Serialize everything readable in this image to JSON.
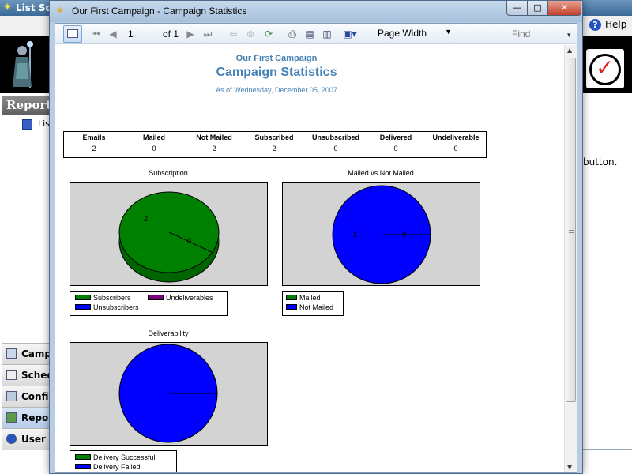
{
  "background_app": {
    "title": "List Sor",
    "help_label": "Help",
    "reports_header": "Report",
    "tree_item": "List",
    "nav_items": [
      "Campa",
      "Sched",
      "Config",
      "Repor",
      "User F"
    ],
    "fragment_text": "button."
  },
  "window": {
    "title": "Our First Campaign - Campaign Statistics",
    "minimize": "—",
    "maximize": "□",
    "close": "✕"
  },
  "toolbar": {
    "page_value": "1",
    "of_label": "of 1",
    "zoom": "Page Width",
    "find_placeholder": "Find"
  },
  "report": {
    "campaign": "Our First Campaign",
    "title": "Campaign Statistics",
    "as_of": "As of Wednesday, December 05, 2007",
    "stats": [
      {
        "label": "Emails",
        "value": "2"
      },
      {
        "label": "Mailed",
        "value": "0"
      },
      {
        "label": "Not Mailed",
        "value": "2"
      },
      {
        "label": "Subscribed",
        "value": "2"
      },
      {
        "label": "Unsubscribed",
        "value": "0"
      },
      {
        "label": "Delivered",
        "value": "0"
      },
      {
        "label": "Undeliverable",
        "value": "0"
      }
    ]
  },
  "colors": {
    "green": "#008000",
    "blue": "#0000ff",
    "purple": "#800080",
    "chart_bg": "#d3d3d3",
    "header_blue": "#4682b4"
  },
  "chart_data": [
    {
      "type": "pie",
      "title": "Subscription",
      "slices": [
        {
          "name": "Subscribers",
          "value": 2,
          "color": "#008000"
        },
        {
          "name": "Undeliverables",
          "value": 0,
          "color": "#800080"
        },
        {
          "name": "Unsubscribers",
          "value": 0,
          "color": "#0000ff"
        }
      ],
      "data_labels": [
        "2",
        "0"
      ]
    },
    {
      "type": "pie",
      "title": "Mailed vs Not Mailed",
      "slices": [
        {
          "name": "Mailed",
          "value": 0,
          "color": "#008000"
        },
        {
          "name": "Not Mailed",
          "value": 2,
          "color": "#0000ff"
        }
      ],
      "data_labels": [
        "2",
        "0"
      ]
    },
    {
      "type": "pie",
      "title": "Deliverability",
      "slices": [
        {
          "name": "Delivery Successful",
          "value": 0,
          "color": "#008000"
        },
        {
          "name": "Delivery Failed",
          "value": 0,
          "color": "#0000ff"
        }
      ],
      "data_labels": []
    }
  ]
}
